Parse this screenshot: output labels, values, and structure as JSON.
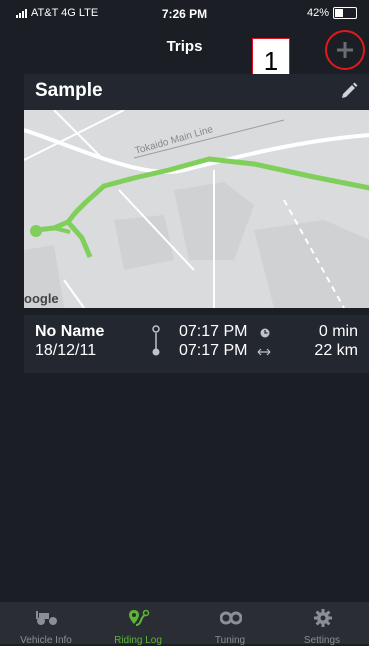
{
  "status_bar": {
    "carrier": "AT&T 4G  LTE",
    "time": "7:26 PM",
    "battery": "42%",
    "battery_level": 0.42
  },
  "nav": {
    "title": "Trips",
    "callout_number": "1",
    "add_icon": "plus-icon"
  },
  "trip_card": {
    "title": "Sample",
    "edit_icon": "pencil-icon",
    "map": {
      "rail_label": "Tokaido Main Line",
      "attribution": "oogle",
      "route_color": "#7fcf5a"
    },
    "name": "No Name",
    "date": "18/12/11",
    "start_time": "07:17 PM",
    "end_time": "07:17 PM",
    "duration": "0 min",
    "distance": "22 km"
  },
  "tabs": [
    {
      "label": "Vehicle Info",
      "icon": "motorcycle-icon"
    },
    {
      "label": "Riding Log",
      "icon": "route-pin-icon",
      "active": true
    },
    {
      "label": "Tuning",
      "icon": "tuning-icon"
    },
    {
      "label": "Settings",
      "icon": "gear-icon"
    }
  ],
  "colors": {
    "background": "#1b1e25",
    "card": "#23272f",
    "accent": "#5cb636",
    "highlight": "#e01a1a"
  }
}
